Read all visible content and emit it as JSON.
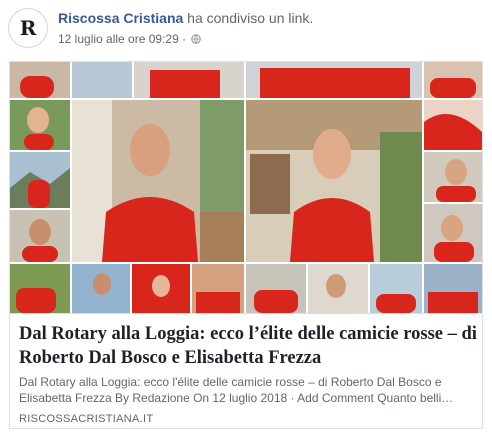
{
  "post": {
    "page_name": "Riscossa Cristiana",
    "action_text": " ha condiviso un link.",
    "timestamp": "12 luglio alle ore 09:29 ·",
    "audience_icon": "globe-icon",
    "avatar_icon": "riscossa-logo-icon"
  },
  "link_card": {
    "title": "Dal Rotary alla Loggia: ecco l’élite delle camicie rosse – di Roberto Dal Bosco e Elisabetta Frezza",
    "description": "Dal Rotary alla Loggia: ecco l'élite delle camicie rosse – di Roberto Dal Bosco e Elisabetta Frezza By Redazione On 12 luglio 2018 · Add Comment Quanto belli…",
    "domain": "RISCOSSACRISTIANA.IT",
    "image": "collage-red-shirts-image"
  },
  "colors": {
    "link_blue": "#385898",
    "meta_gray": "#616770",
    "shirt_red": "#d9261c",
    "border": "#dddfe2"
  }
}
